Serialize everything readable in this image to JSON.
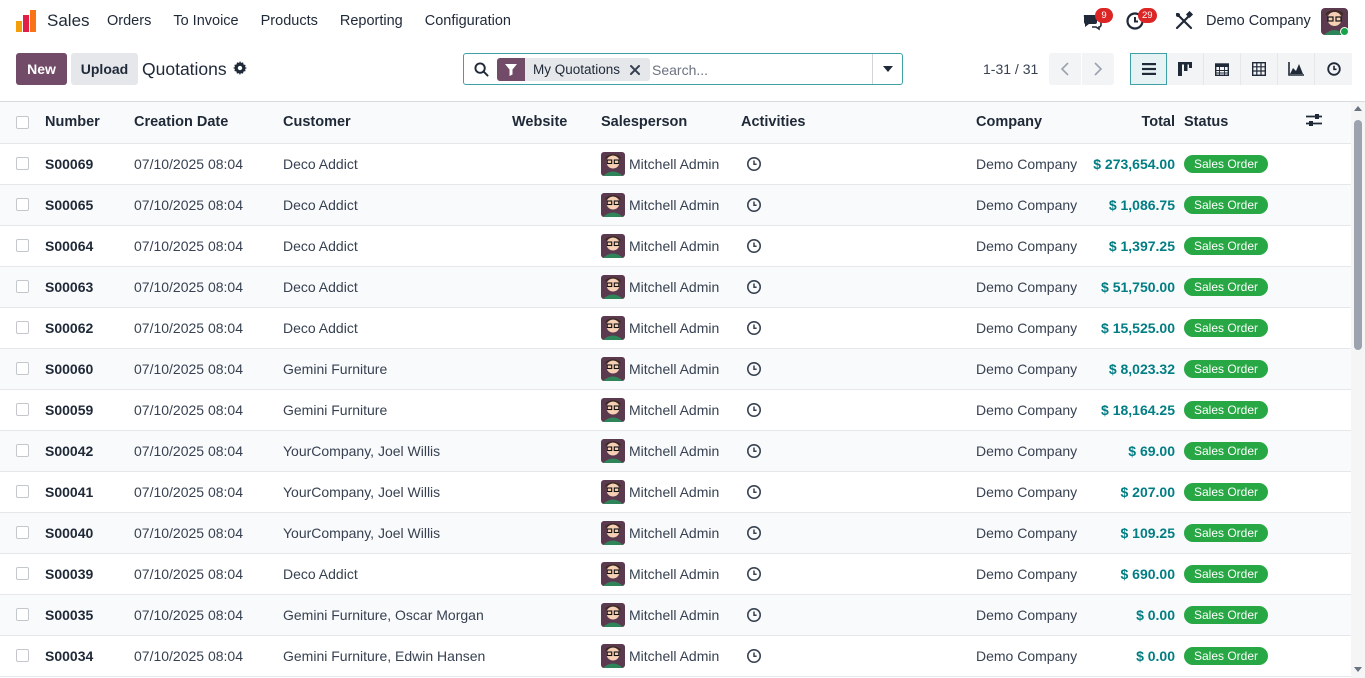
{
  "navbar": {
    "app_name": "Sales",
    "menu": [
      "Orders",
      "To Invoice",
      "Products",
      "Reporting",
      "Configuration"
    ],
    "messages_count": "9",
    "activities_count": "29",
    "company": "Demo Company"
  },
  "control": {
    "new_label": "New",
    "upload_label": "Upload",
    "title": "Quotations",
    "facet_label": "My Quotations",
    "search_placeholder": "Search...",
    "pager": "1-31 / 31"
  },
  "table": {
    "columns": [
      "Number",
      "Creation Date",
      "Customer",
      "Website",
      "Salesperson",
      "Activities",
      "Company",
      "Total",
      "Status"
    ],
    "rows": [
      {
        "number": "S00069",
        "date": "07/10/2025 08:04",
        "customer": "Deco Addict",
        "website": "",
        "salesperson": "Mitchell Admin",
        "company": "Demo Company",
        "total": "$ 273,654.00",
        "status": "Sales Order"
      },
      {
        "number": "S00065",
        "date": "07/10/2025 08:04",
        "customer": "Deco Addict",
        "website": "",
        "salesperson": "Mitchell Admin",
        "company": "Demo Company",
        "total": "$ 1,086.75",
        "status": "Sales Order"
      },
      {
        "number": "S00064",
        "date": "07/10/2025 08:04",
        "customer": "Deco Addict",
        "website": "",
        "salesperson": "Mitchell Admin",
        "company": "Demo Company",
        "total": "$ 1,397.25",
        "status": "Sales Order"
      },
      {
        "number": "S00063",
        "date": "07/10/2025 08:04",
        "customer": "Deco Addict",
        "website": "",
        "salesperson": "Mitchell Admin",
        "company": "Demo Company",
        "total": "$ 51,750.00",
        "status": "Sales Order"
      },
      {
        "number": "S00062",
        "date": "07/10/2025 08:04",
        "customer": "Deco Addict",
        "website": "",
        "salesperson": "Mitchell Admin",
        "company": "Demo Company",
        "total": "$ 15,525.00",
        "status": "Sales Order"
      },
      {
        "number": "S00060",
        "date": "07/10/2025 08:04",
        "customer": "Gemini Furniture",
        "website": "",
        "salesperson": "Mitchell Admin",
        "company": "Demo Company",
        "total": "$ 8,023.32",
        "status": "Sales Order"
      },
      {
        "number": "S00059",
        "date": "07/10/2025 08:04",
        "customer": "Gemini Furniture",
        "website": "",
        "salesperson": "Mitchell Admin",
        "company": "Demo Company",
        "total": "$ 18,164.25",
        "status": "Sales Order"
      },
      {
        "number": "S00042",
        "date": "07/10/2025 08:04",
        "customer": "YourCompany, Joel Willis",
        "website": "",
        "salesperson": "Mitchell Admin",
        "company": "Demo Company",
        "total": "$ 69.00",
        "status": "Sales Order"
      },
      {
        "number": "S00041",
        "date": "07/10/2025 08:04",
        "customer": "YourCompany, Joel Willis",
        "website": "",
        "salesperson": "Mitchell Admin",
        "company": "Demo Company",
        "total": "$ 207.00",
        "status": "Sales Order"
      },
      {
        "number": "S00040",
        "date": "07/10/2025 08:04",
        "customer": "YourCompany, Joel Willis",
        "website": "",
        "salesperson": "Mitchell Admin",
        "company": "Demo Company",
        "total": "$ 109.25",
        "status": "Sales Order"
      },
      {
        "number": "S00039",
        "date": "07/10/2025 08:04",
        "customer": "Deco Addict",
        "website": "",
        "salesperson": "Mitchell Admin",
        "company": "Demo Company",
        "total": "$ 690.00",
        "status": "Sales Order"
      },
      {
        "number": "S00035",
        "date": "07/10/2025 08:04",
        "customer": "Gemini Furniture, Oscar Morgan",
        "website": "",
        "salesperson": "Mitchell Admin",
        "company": "Demo Company",
        "total": "$ 0.00",
        "status": "Sales Order"
      },
      {
        "number": "S00034",
        "date": "07/10/2025 08:04",
        "customer": "Gemini Furniture, Edwin Hansen",
        "website": "",
        "salesperson": "Mitchell Admin",
        "company": "Demo Company",
        "total": "$ 0.00",
        "status": "Sales Order"
      }
    ]
  },
  "colors": {
    "brand": "#714b67",
    "accent": "#017e84",
    "status_green": "#28a745",
    "badge_red": "#dc2626"
  },
  "icons": {
    "logo": "sales-app-icon",
    "messages": "chat-icon",
    "activities": "clock-icon",
    "debug": "tools-icon",
    "search": "search-icon",
    "filter": "filter-icon",
    "remove": "close-icon",
    "settings": "gear-icon",
    "optional_columns": "sliders-icon",
    "views": [
      "list-icon",
      "kanban-icon",
      "calendar-icon",
      "pivot-icon",
      "graph-icon",
      "activity-icon"
    ]
  }
}
